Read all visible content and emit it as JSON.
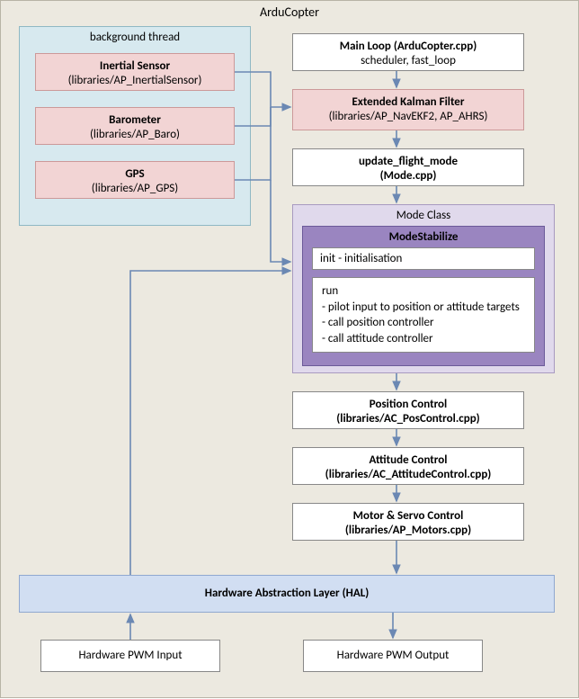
{
  "canvas": {
    "title": "ArduCopter"
  },
  "bg_group": {
    "title": "background thread"
  },
  "sensors": {
    "inertial": {
      "title": "Inertial Sensor",
      "path": "(libraries/AP_InertialSensor)"
    },
    "baro": {
      "title": "Barometer",
      "path": "(libraries/AP_Baro)"
    },
    "gps": {
      "title": "GPS",
      "path": "(libraries/AP_GPS)"
    }
  },
  "main_loop": {
    "title": "Main Loop (ArduCopter.cpp)",
    "sub": "scheduler, fast_loop"
  },
  "ekf": {
    "title": "Extended Kalman Filter",
    "path": "(libraries/AP_NavEKF2, AP_AHRS)"
  },
  "ufm": {
    "title": "update_flight_mode",
    "path": "(Mode.cpp)"
  },
  "mode_group": {
    "title": "Mode Class"
  },
  "mode_stabilize": {
    "title": "ModeStabilize"
  },
  "init_box": "init - initialisation",
  "run_box": {
    "line1": "run",
    "line2": "- pilot input to position or attitude targets",
    "line3": "- call position controller",
    "line4": "- call attitude controller"
  },
  "pos_ctrl": {
    "title": "Position Control",
    "path": "(libraries/AC_PosControl.cpp)"
  },
  "att_ctrl": {
    "title": "Attitude Control",
    "path": "(libraries/AC_AttitudeControl.cpp)"
  },
  "motor_ctrl": {
    "title": "Motor & Servo Control",
    "path": "(libraries/AP_Motors.cpp)"
  },
  "hal": "Hardware Abstraction Layer (HAL)",
  "pwm_in": "Hardware PWM Input",
  "pwm_out": "Hardware PWM Output"
}
